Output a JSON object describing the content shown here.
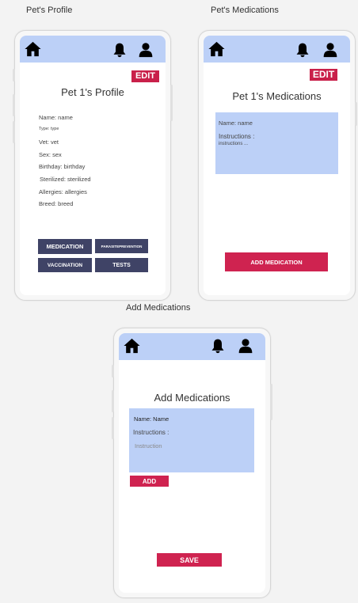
{
  "captions": {
    "profile": "Pet's Profile",
    "medications": "Pet's Medications",
    "add_medications": "Add Medications"
  },
  "icons": {
    "home": "home-icon",
    "bell": "bell-icon",
    "user": "user-icon"
  },
  "colors": {
    "appbar": "#bcd0f7",
    "accent": "#c9204a",
    "navy": "#3f4366"
  },
  "profile": {
    "edit_label": "EDIT",
    "title": "Pet 1's Profile",
    "fields": {
      "name": "Name: name",
      "type": "Type: type",
      "vet": "Vet: vet",
      "sex": "Sex: sex",
      "birthday": "Birthday: birthday",
      "sterilized": "Sterilized: sterilized",
      "allergies": "Allergies: allergies",
      "breed": "Breed: breed"
    },
    "buttons": {
      "medication": "MEDICATION",
      "parasite": "PARASITEPREVENTION",
      "vaccination": "VACCINATION",
      "tests": "TESTS"
    }
  },
  "medications": {
    "edit_label": "EDIT",
    "title": "Pet 1's Medications",
    "card": {
      "name": "Name: name",
      "instructions_label": "Instructions :",
      "instructions_value": "instructions ..."
    },
    "add_button": "ADD MEDICATION"
  },
  "add_medications": {
    "title": "Add Medications",
    "form": {
      "name": "Name: Name",
      "instructions_label": "Instructions :",
      "instruction_placeholder": "Instruction"
    },
    "add_button": "ADD",
    "save_button": "SAVE"
  }
}
